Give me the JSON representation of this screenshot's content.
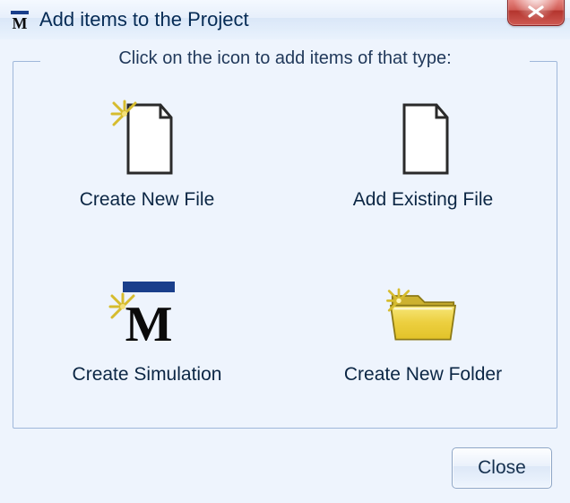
{
  "window": {
    "title": "Add items to the Project"
  },
  "group": {
    "legend": "Click on the icon to add items of that type:"
  },
  "items": {
    "newFile": "Create New File",
    "existingFile": "Add Existing File",
    "simulation": "Create Simulation",
    "newFolder": "Create New Folder"
  },
  "footer": {
    "close": "Close"
  }
}
